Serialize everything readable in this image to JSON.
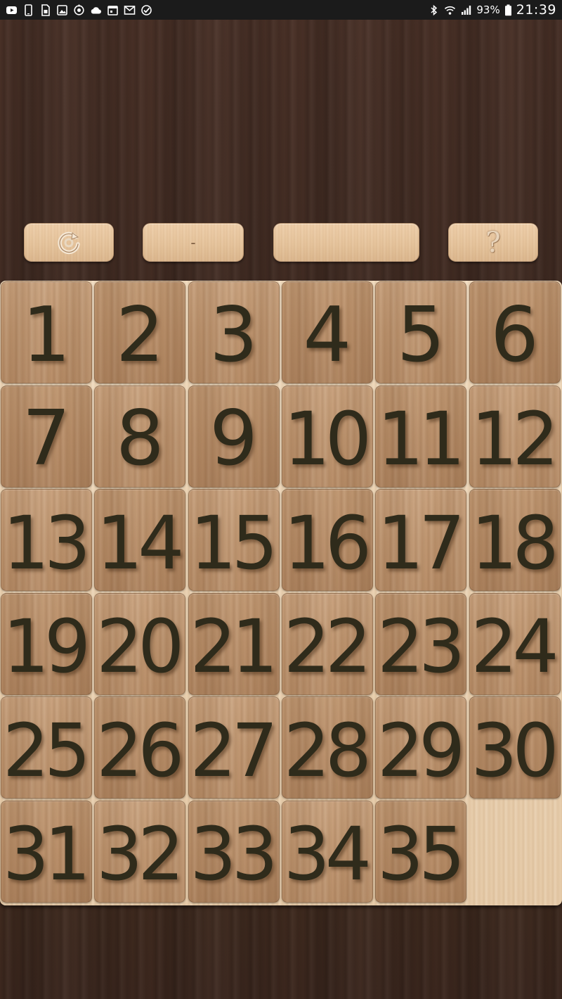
{
  "status_bar": {
    "battery": "93%",
    "time": "21:39",
    "left_icons": [
      "youtube-icon",
      "phone-icon",
      "sim-card-icon",
      "image-icon",
      "sync-icon",
      "cloud-icon",
      "calendar-icon",
      "gmail-icon",
      "check-circle-icon"
    ],
    "right_icons": [
      "bluetooth-icon",
      "wifi-icon",
      "signal-icon",
      "battery-icon"
    ]
  },
  "toolbar": {
    "restart_icon": "restart-icon",
    "moves_label": "-",
    "time_label": "",
    "help_label": "?"
  },
  "board": {
    "columns": 6,
    "rows": 6,
    "tiles": [
      "1",
      "2",
      "3",
      "4",
      "5",
      "6",
      "7",
      "8",
      "9",
      "10",
      "11",
      "12",
      "13",
      "14",
      "15",
      "16",
      "17",
      "18",
      "19",
      "20",
      "21",
      "22",
      "23",
      "24",
      "25",
      "26",
      "27",
      "28",
      "29",
      "30",
      "31",
      "32",
      "33",
      "34",
      "35",
      ""
    ]
  },
  "colors": {
    "wood_dark": "#45301f",
    "tile_wood": "#bf9670",
    "button_wood": "#e6c49c",
    "digit": "#2f2b1b"
  }
}
